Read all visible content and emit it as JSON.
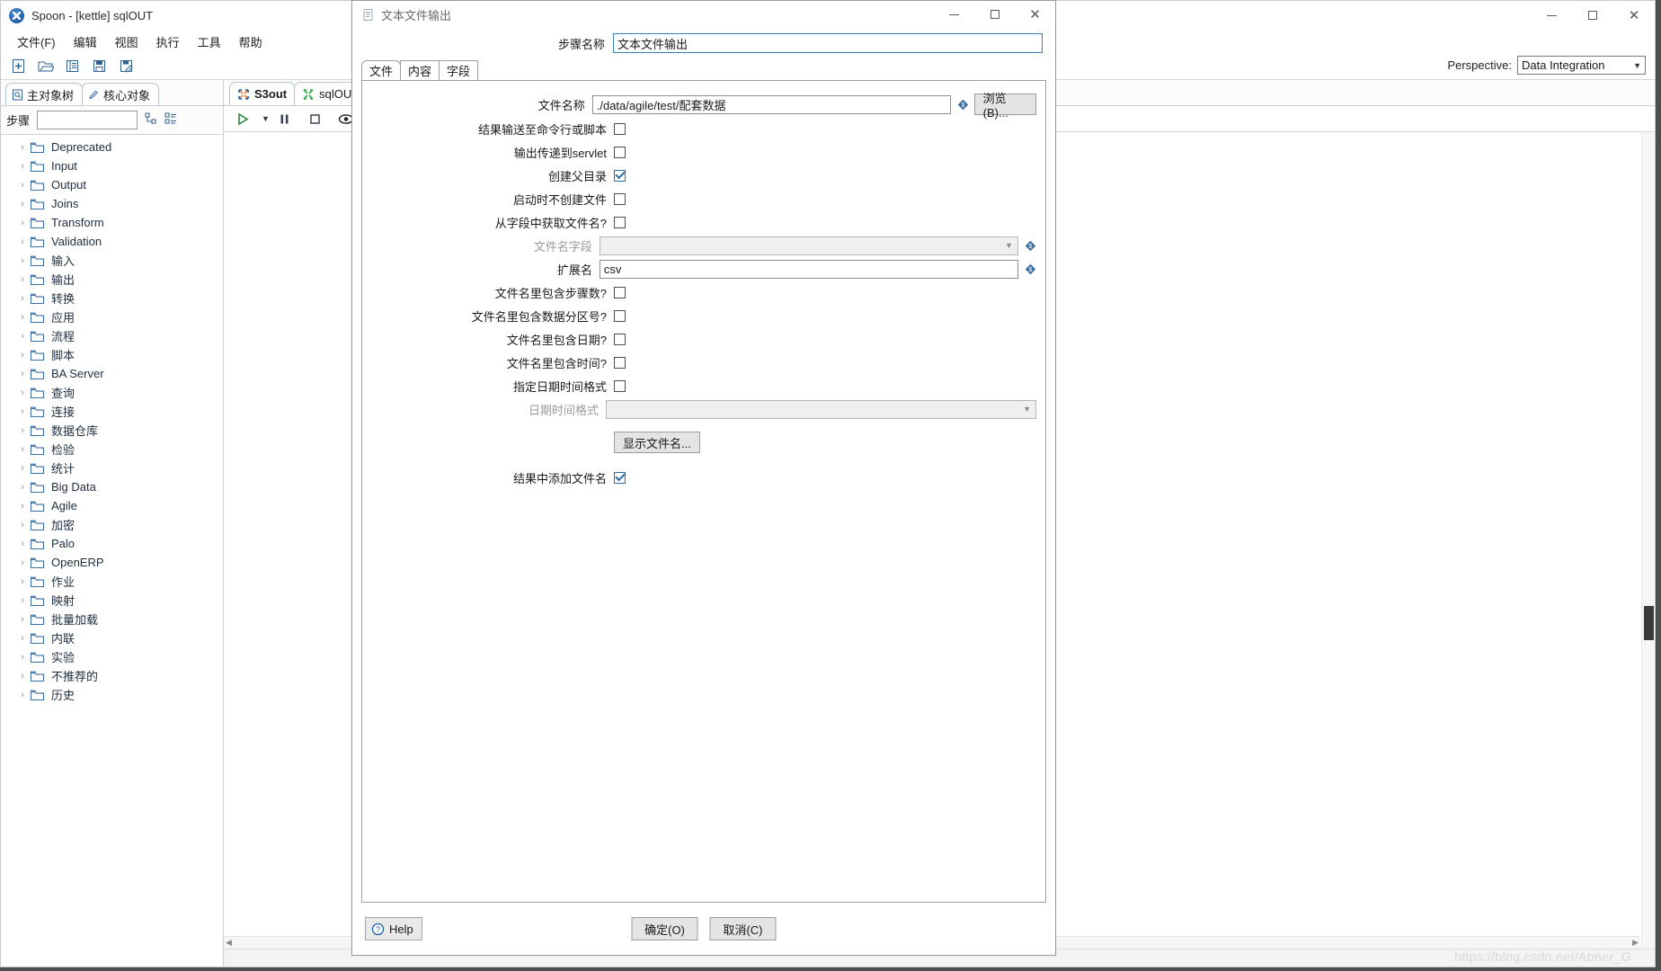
{
  "app": {
    "title": "Spoon - [kettle] sqlOUT",
    "icon": "spoon-app-icon",
    "window_controls": [
      "minimize",
      "maximize",
      "close"
    ],
    "menus": [
      "文件(F)",
      "编辑",
      "视图",
      "执行",
      "工具",
      "帮助"
    ],
    "toolbar_icons": [
      "new-file-icon",
      "open-folder-icon",
      "explorer-icon",
      "save-icon",
      "save-as-icon"
    ],
    "perspective": {
      "label": "Perspective:",
      "value": "Data Integration",
      "caret": "chevron-down-icon"
    }
  },
  "left_panel": {
    "tabs": [
      {
        "label": "主对象树",
        "icon": "document-tree-icon",
        "active": false
      },
      {
        "label": "核心对象",
        "icon": "pencil-icon",
        "active": true
      }
    ],
    "search": {
      "label": "步骤",
      "value": "",
      "placeholder": ""
    },
    "tools": [
      "expand-all-icon",
      "collapse-all-icon"
    ],
    "tree_items": [
      "Deprecated",
      "Input",
      "Output",
      "Joins",
      "Transform",
      "Validation",
      "输入",
      "输出",
      "转换",
      "应用",
      "流程",
      "脚本",
      "BA Server",
      "查询",
      "连接",
      "数据仓库",
      "检验",
      "统计",
      "Big Data",
      "Agile",
      "加密",
      "Palo",
      "OpenERP",
      "作业",
      "映射",
      "批量加载",
      "内联",
      "实验",
      "不推荐的",
      "历史"
    ]
  },
  "workspace": {
    "tabs": [
      {
        "label": "S3out",
        "icon": "transformation-icon",
        "active": true,
        "closable": false
      },
      {
        "label": "sqlOUT",
        "icon": "transformation-green-icon",
        "active": false,
        "closable": true
      }
    ],
    "toolbar_icons": [
      "run-icon",
      "run-dropdown-caret",
      "pause-icon",
      "stop-icon",
      "preview-icon",
      "debug-icon",
      "replay-icon",
      "verify-icon",
      "analyze-icon"
    ]
  },
  "statusbar": {
    "watermark": "https://blog.csdn.net/Abner_G"
  },
  "dialog": {
    "title": "文本文件输出",
    "title_icon": "text-file-output-icon",
    "window_controls": [
      "minimize",
      "maximize",
      "close"
    ],
    "step_name": {
      "label": "步骤名称",
      "value": "文本文件输出"
    },
    "tabs": [
      {
        "label": "文件",
        "active": true
      },
      {
        "label": "内容",
        "active": false
      },
      {
        "label": "字段",
        "active": false
      }
    ],
    "fields": {
      "file_name": {
        "label": "文件名称",
        "value": "./data/agile/test/配套数据",
        "variable_icon": "variable-diamond-icon",
        "browse_button": "浏览(B)..."
      },
      "pass_to_servlet_cmd": {
        "label": "结果输送至命令行或脚本",
        "checked": false
      },
      "output_to_servlet": {
        "label": "输出传递到servlet",
        "checked": false
      },
      "create_parent_folder": {
        "label": "创建父目录",
        "checked": true
      },
      "do_not_create_at_start": {
        "label": "启动时不创建文件",
        "checked": false
      },
      "filename_from_field": {
        "label": "从字段中获取文件名?",
        "checked": false
      },
      "filename_field": {
        "label": "文件名字段",
        "value": "",
        "disabled": true,
        "variable_icon": "variable-diamond-icon"
      },
      "extension": {
        "label": "扩展名",
        "value": "csv",
        "variable_icon": "variable-diamond-icon"
      },
      "include_stepnr": {
        "label": "文件名里包含步骤数?",
        "checked": false
      },
      "include_partnr": {
        "label": "文件名里包含数据分区号?",
        "checked": false
      },
      "include_date": {
        "label": "文件名里包含日期?",
        "checked": false
      },
      "include_time": {
        "label": "文件名里包含时间?",
        "checked": false
      },
      "specify_date_format": {
        "label": "指定日期时间格式",
        "checked": false
      },
      "date_time_format": {
        "label": "日期时间格式",
        "value": "",
        "disabled": true
      },
      "show_filenames_button": {
        "label": "显示文件名..."
      },
      "add_filename_to_result": {
        "label": "结果中添加文件名",
        "checked": true
      }
    },
    "footer": {
      "help": "Help",
      "help_icon": "question-circle-icon",
      "ok": "确定(O)",
      "cancel": "取消(C)"
    }
  }
}
